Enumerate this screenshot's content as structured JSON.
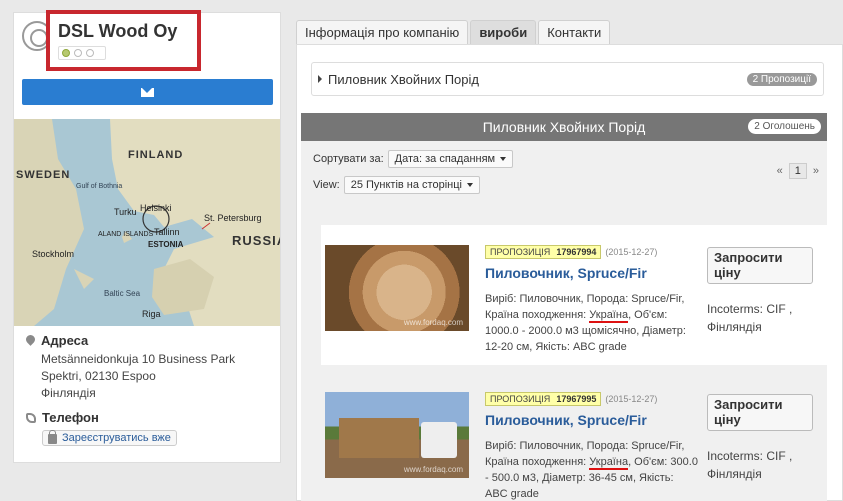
{
  "company": {
    "name": "DSL Wood Oy",
    "map_labels": {
      "finland": "FINLAND",
      "sweden": "SWEDEN",
      "russia": "RUSSIA",
      "estonia": "ESTONIA",
      "aland": "ALAND ISLANDS",
      "gulf": "Gulf of Bothnia",
      "baltic": "Baltic Sea",
      "helsinki": "Helsinki",
      "stpetersburg": "St. Petersburg",
      "stockholm": "Stockholm",
      "tallinn": "Tallinn",
      "turku": "Turku",
      "riga": "Riga"
    },
    "address_label": "Адреса",
    "address_line1": "Metsänneidonkuja 10 Business Park",
    "address_line2": "Spektri, 02130 Espoo",
    "address_line3": "Фінляндія",
    "phone_label": "Телефон",
    "register_label": "Зареєструватись вже"
  },
  "tabs": [
    {
      "label": "Інформація про компанію"
    },
    {
      "label": "вироби"
    },
    {
      "label": "Контакти"
    }
  ],
  "category": {
    "title": "Пиловник Хвойних Порід",
    "badge": "2 Пропозиції"
  },
  "section": {
    "title": "Пиловник Хвойних Порід",
    "badge": "2 Оголошень",
    "sort_label": "Сортувати за:",
    "sort_value": "Дата: за спаданням",
    "view_label": "View:",
    "view_value": "25 Пунктів на сторінці",
    "pager_prev": "«",
    "pager_current": "1",
    "pager_next": "»"
  },
  "offers": [
    {
      "tag": "ПРОПОЗИЦІЯ",
      "id": "17967994",
      "date": "(2015-12-27)",
      "title": "Пиловочник, Spruce/Fir",
      "desc_prefix": "Виріб: Пиловочник, Порода: Spruce/Fir, Країна походження: ",
      "desc_country": "Україна",
      "desc_suffix": ", Об'єм: 1000.0 - 2000.0 м3 щомісячно, Діаметр: 12-20 см, Якість: ABC grade",
      "quote_label": "Запросити ціну",
      "incoterms": "Incoterms: CIF , Фінляндія",
      "watermark": "www.fordaq.com"
    },
    {
      "tag": "ПРОПОЗИЦІЯ",
      "id": "17967995",
      "date": "(2015-12-27)",
      "title": "Пиловочник, Spruce/Fir",
      "desc_prefix": "Виріб: Пиловочник, Порода: Spruce/Fir, Країна походження: ",
      "desc_country": "Україна",
      "desc_suffix": ", Об'єм: 300.0 - 500.0 м3, Діаметр: 36-45 см, Якість: ABC grade",
      "quote_label": "Запросити ціну",
      "incoterms": "Incoterms: CIF , Фінляндія",
      "watermark": "www.fordaq.com"
    }
  ]
}
